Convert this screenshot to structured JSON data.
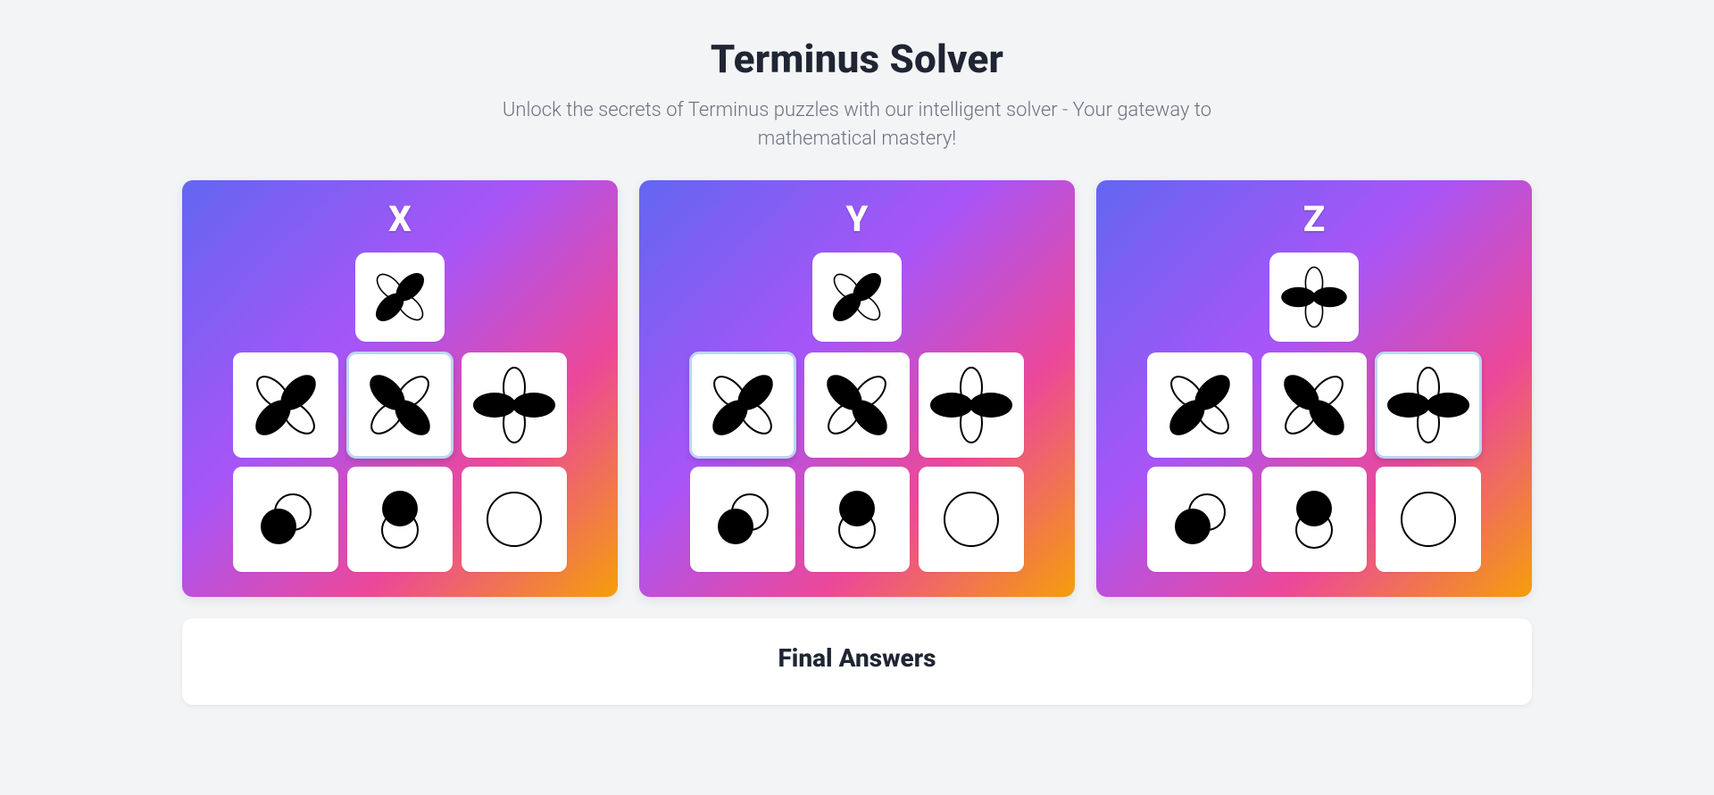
{
  "header": {
    "title": "Terminus Solver",
    "subtitle": "Unlock the secrets of Terminus puzzles with our intelligent solver - Your gateway to mathematical mastery!"
  },
  "panels": [
    {
      "letter": "X",
      "preview_symbol": "flower-ne-sw-fill",
      "rows": [
        {
          "options": [
            {
              "symbol": "flower-ne-sw-fill",
              "selected": false
            },
            {
              "symbol": "flower-nw-se-fill",
              "selected": true
            },
            {
              "symbol": "flower-horiz-fill",
              "selected": false
            }
          ]
        },
        {
          "options": [
            {
              "symbol": "overlap-left-fill",
              "selected": false
            },
            {
              "symbol": "stack-top-fill",
              "selected": false
            },
            {
              "symbol": "circle-outline",
              "selected": false
            }
          ]
        }
      ]
    },
    {
      "letter": "Y",
      "preview_symbol": "flower-ne-sw-fill",
      "rows": [
        {
          "options": [
            {
              "symbol": "flower-ne-sw-fill",
              "selected": true
            },
            {
              "symbol": "flower-nw-se-fill",
              "selected": false
            },
            {
              "symbol": "flower-horiz-fill",
              "selected": false
            }
          ]
        },
        {
          "options": [
            {
              "symbol": "overlap-left-fill",
              "selected": false
            },
            {
              "symbol": "stack-top-fill",
              "selected": false
            },
            {
              "symbol": "circle-outline",
              "selected": false
            }
          ]
        }
      ]
    },
    {
      "letter": "Z",
      "preview_symbol": "flower-horiz-fill",
      "rows": [
        {
          "options": [
            {
              "symbol": "flower-ne-sw-fill",
              "selected": false
            },
            {
              "symbol": "flower-nw-se-fill",
              "selected": false
            },
            {
              "symbol": "flower-horiz-fill",
              "selected": true
            }
          ]
        },
        {
          "options": [
            {
              "symbol": "overlap-left-fill",
              "selected": false
            },
            {
              "symbol": "stack-top-fill",
              "selected": false
            },
            {
              "symbol": "circle-outline",
              "selected": false
            }
          ]
        }
      ]
    }
  ],
  "answers": {
    "title": "Final Answers"
  }
}
